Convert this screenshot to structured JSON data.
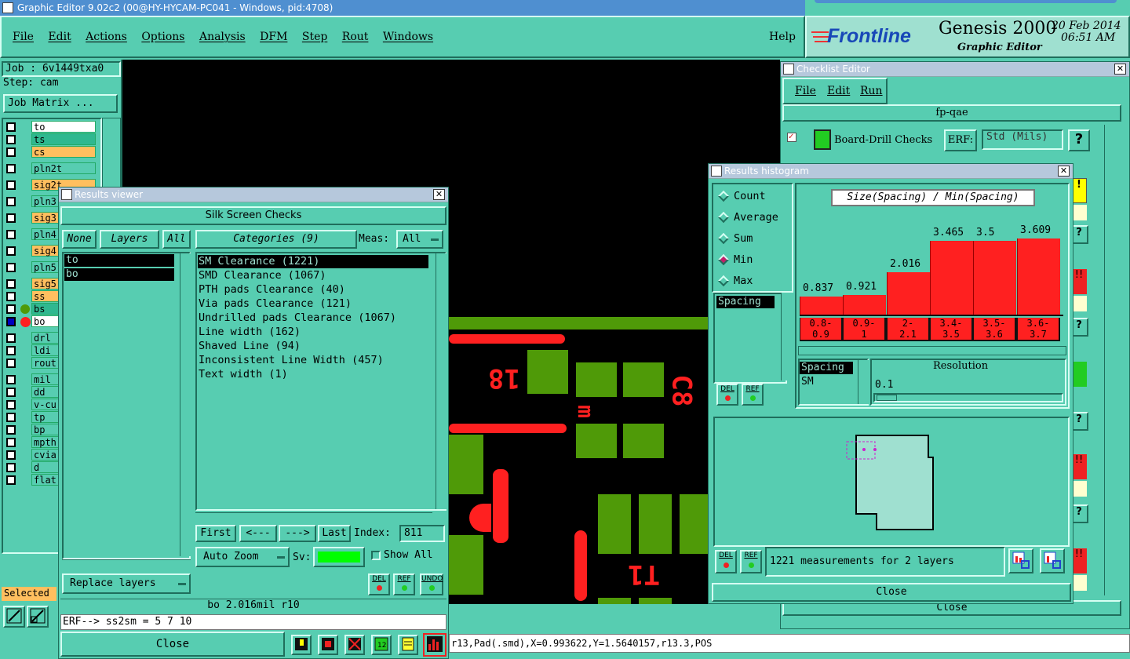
{
  "window": {
    "title": "Graphic Editor 9.02c2 (00@HY-HYCAM-PC041 - Windows, pid:4708)"
  },
  "menubar": {
    "items": [
      "File",
      "Edit",
      "Actions",
      "Options",
      "Analysis",
      "DFM",
      "Step",
      "Rout",
      "Windows"
    ],
    "help": "Help"
  },
  "brand": {
    "logo": "Frontline",
    "product": "Genesis 2000",
    "subtitle": "Graphic Editor",
    "date": "20 Feb 2014",
    "time": "06:51 AM"
  },
  "left_panel": {
    "job": "Job : 6v1449txa0",
    "step": "Step: cam",
    "job_matrix": "Job Matrix ...",
    "layers": [
      "to",
      "ts",
      "cs",
      "pln2t",
      "sig2t",
      "pln3",
      "sig3",
      "pln4",
      "sig4",
      "pln5",
      "sig5",
      "ss",
      "bs",
      "bo",
      "drl",
      "ldi",
      "rout",
      "mil",
      "dd",
      "v-cu",
      "tp",
      "bp",
      "mpth",
      "cvia",
      "d",
      "flat"
    ],
    "selected": "Selected"
  },
  "results_viewer": {
    "title": "Results viewer",
    "header": "Silk Screen Checks",
    "none": "None",
    "layers": "Layers",
    "all": "All",
    "categories_label": "Categories (9)",
    "meas_label": "Meas:",
    "meas_value": "All",
    "layer_items": [
      "to",
      "bo"
    ],
    "category_items": [
      "SM Clearance (1221)",
      "SMD Clearance (1067)",
      "PTH pads Clearance (40)",
      "Via pads Clearance (121)",
      "Undrilled pads Clearance (1067)",
      "Line width (162)",
      "Shaved Line (94)",
      "Inconsistent Line Width (457)",
      "Text width (1)"
    ],
    "first": "First",
    "prev": "<---",
    "next": "--->",
    "last": "Last",
    "index_label": "Index:",
    "index_value": "811",
    "auto_zoom": "Auto Zoom",
    "sv": "Sv:",
    "show_all": "Show All",
    "replace_layers": "Replace layers",
    "del": "DEL",
    "ref": "REF",
    "undo": "UNDO",
    "status": "bo 2.016mil  r10",
    "erf": "ERF--> ss2sm = 5 7 10",
    "close": "Close"
  },
  "checklist_editor": {
    "title": "Checklist Editor",
    "menu": [
      "File",
      "Edit",
      "Run"
    ],
    "name": "fp-qae",
    "check": "Board-Drill Checks",
    "erf_label": "ERF:",
    "erf_value": "Std (Mils)",
    "help": "?",
    "close": "Close"
  },
  "histogram": {
    "title": "Results histogram",
    "modes": [
      "Count",
      "Average",
      "Sum",
      "Min",
      "Max"
    ],
    "selected_mode": "Min",
    "chart_title": "Size(Spacing) / Min(Spacing)",
    "bins": [
      "0.8-0.9",
      "0.9-1",
      "2-2.1",
      "3.4-3.5",
      "3.5-3.6",
      "3.6-3.7"
    ],
    "bin_lines": [
      [
        "0.8-",
        "0.9"
      ],
      [
        "0.9-",
        "1"
      ],
      [
        "2-",
        "2.1"
      ],
      [
        "3.4-",
        "3.5"
      ],
      [
        "3.5-",
        "3.6"
      ],
      [
        "3.6-",
        "3.7"
      ]
    ],
    "values": [
      0.837,
      0.921,
      2.016,
      3.465,
      3.5,
      3.609
    ],
    "value_labels": [
      "0.837",
      "0.921",
      "2.016",
      "3.465",
      "3.5",
      "3.609"
    ],
    "list1": [
      "Spacing"
    ],
    "list2": [
      "Spacing",
      "SM"
    ],
    "resolution_label": "Resolution",
    "resolution_value": "0.1",
    "del": "DEL",
    "ref": "REF",
    "summary": "1221 measurements for 2 layers",
    "close": "Close"
  },
  "statusbar": {
    "text": "r13,Pad(.smd),X=0.993622,Y=1.5640157,r13.3,POS"
  }
}
